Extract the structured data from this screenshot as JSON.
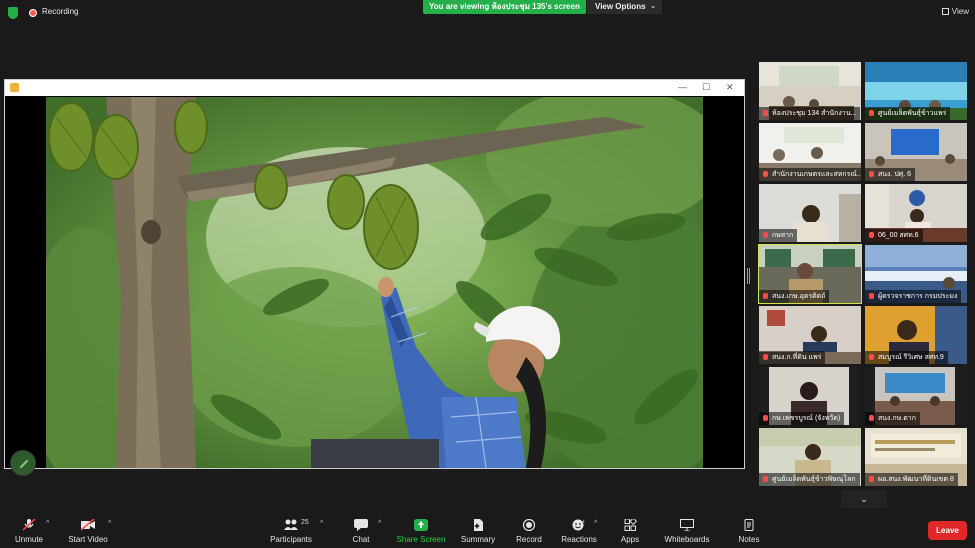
{
  "topbar": {
    "recording_label": "Recording",
    "viewing_banner": "You are viewing ห้องประชุม 135's screen",
    "view_options_label": "View Options",
    "view_label": "View"
  },
  "gallery": {
    "tiles": [
      {
        "label": "ห้องประชุม 134 สำนักงาน..."
      },
      {
        "label": "ศูนย์เมล็ดพันธุ์ข้าวแพร่"
      },
      {
        "label": "สำนักงานเกษตรและสหกรณ์..."
      },
      {
        "label": "สนง. ปศุ. 6"
      },
      {
        "label": "กษสาก"
      },
      {
        "label": "06_00 สศท.6"
      },
      {
        "label": "สนง.เกษ.อุตรดิตถ์"
      },
      {
        "label": "ผู้ตรวจราชการ กรมประมง"
      },
      {
        "label": "สนง.ก.ที่ดิน แพร่"
      },
      {
        "label": "สมบูรณ์ รีวิเศษ สศท.9"
      },
      {
        "label": "กษ.เพชรบูรณ์ (จังหวัด)"
      },
      {
        "label": "สนง.กษ.ตาก"
      },
      {
        "label": "ศูนย์เมล็ดพันธุ์ข้าวพิษณุโลก"
      },
      {
        "label": "ผอ.สนง.พัฒนาที่ดินเขต 8"
      }
    ]
  },
  "toolbar": {
    "unmute": "Unmute",
    "start_video": "Start Video",
    "participants": "Participants",
    "participants_count": "25",
    "chat": "Chat",
    "share_screen": "Share Screen",
    "summary": "Summary",
    "record": "Record",
    "reactions": "Reactions",
    "apps": "Apps",
    "whiteboards": "Whiteboards",
    "notes": "Notes",
    "leave": "Leave"
  },
  "colors": {
    "accent_green": "#23b04a",
    "leave_red": "#e02828",
    "active_speaker": "#d7e24a"
  }
}
